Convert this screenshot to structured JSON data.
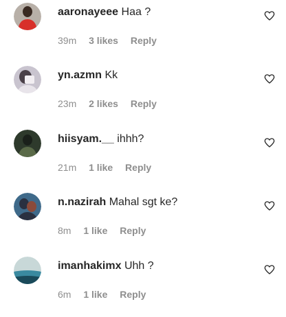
{
  "comments": [
    {
      "username": "aaronayeee",
      "text": "Haa ?",
      "time": "39m",
      "likes": "3 likes",
      "reply": "Reply",
      "avatar_colors": [
        "#b8b0a8",
        "#d8302a",
        "#3a2a22"
      ]
    },
    {
      "username": "yn.azmn",
      "text": "Kk",
      "time": "23m",
      "likes": "2 likes",
      "reply": "Reply",
      "avatar_colors": [
        "#c9c4cf",
        "#f2eef2",
        "#4a4048"
      ]
    },
    {
      "username": "hiisyam.__",
      "text": "ihhh?",
      "time": "21m",
      "likes": "1 like",
      "reply": "Reply",
      "avatar_colors": [
        "#2e3a2c",
        "#5a6a48",
        "#1a201a"
      ]
    },
    {
      "username": "n.nazirah",
      "text": "Mahal sgt ke?",
      "time": "8m",
      "likes": "1 like",
      "reply": "Reply",
      "avatar_colors": [
        "#3f6a8a",
        "#8a4a3a",
        "#2a3040"
      ]
    },
    {
      "username": "imanhakimx",
      "text": "Uhh ?",
      "time": "6m",
      "likes": "1 like",
      "reply": "Reply",
      "avatar_colors": [
        "#c8d8d8",
        "#3a8aa0",
        "#1a4a5a"
      ]
    }
  ],
  "icons": {
    "like": "heart-outline-icon"
  },
  "colors": {
    "text_primary": "#262626",
    "text_secondary": "#8e8e8e"
  }
}
